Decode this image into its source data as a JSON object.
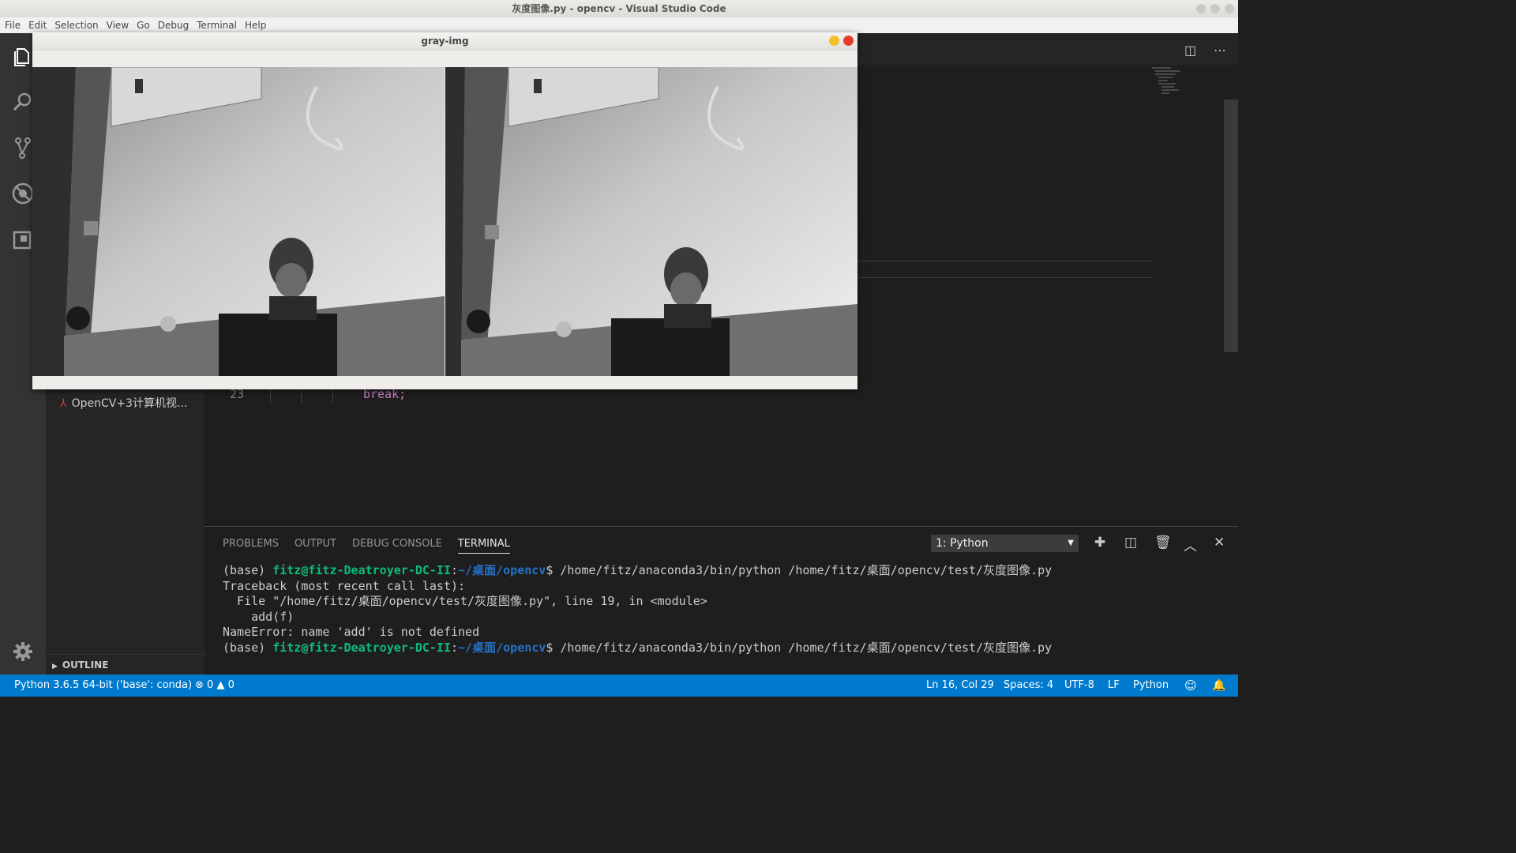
{
  "window": {
    "title": "灰度图像.py - opencv - Visual Studio Code"
  },
  "menu": [
    "File",
    "Edit",
    "Selection",
    "View",
    "Go",
    "Debug",
    "Terminal",
    "Help"
  ],
  "activity_icons": [
    "files-icon",
    "search-icon",
    "source-control-icon",
    "debug-icon",
    "extensions-icon",
    "gear-icon"
  ],
  "sidebar": {
    "open_file": "OpenCV+3计算机视...",
    "outline_label": "OUTLINE"
  },
  "editor": {
    "line_number": "23",
    "code": "break;"
  },
  "cv_window": {
    "title": "gray-img"
  },
  "panel": {
    "tabs": [
      "PROBLEMS",
      "OUTPUT",
      "DEBUG CONSOLE",
      "TERMINAL"
    ],
    "active_tab": "TERMINAL",
    "terminal_select": "1: Python",
    "lines": [
      {
        "prefix": "(base) ",
        "user": "fitz@fitz-Deatroyer-DC-II",
        "sep": ":",
        "path": "~/桌面/opencv",
        "rest": "$ /home/fitz/anaconda3/bin/python /home/fitz/桌面/opencv/test/灰度图像.py"
      },
      {
        "text": "Traceback (most recent call last):"
      },
      {
        "text": "  File \"/home/fitz/桌面/opencv/test/灰度图像.py\", line 19, in <module>"
      },
      {
        "text": "    add(f)"
      },
      {
        "text": "NameError: name 'add' is not defined"
      },
      {
        "prefix": "(base) ",
        "user": "fitz@fitz-Deatroyer-DC-II",
        "sep": ":",
        "path": "~/桌面/opencv",
        "rest": "$ /home/fitz/anaconda3/bin/python /home/fitz/桌面/opencv/test/灰度图像.py"
      }
    ]
  },
  "status": {
    "interpreter": "Python 3.6.5 64-bit ('base': conda)",
    "errors": "0",
    "warnings": "0",
    "position": "Ln 16, Col 29",
    "spaces": "Spaces: 4",
    "encoding": "UTF-8",
    "eol": "LF",
    "language": "Python"
  }
}
